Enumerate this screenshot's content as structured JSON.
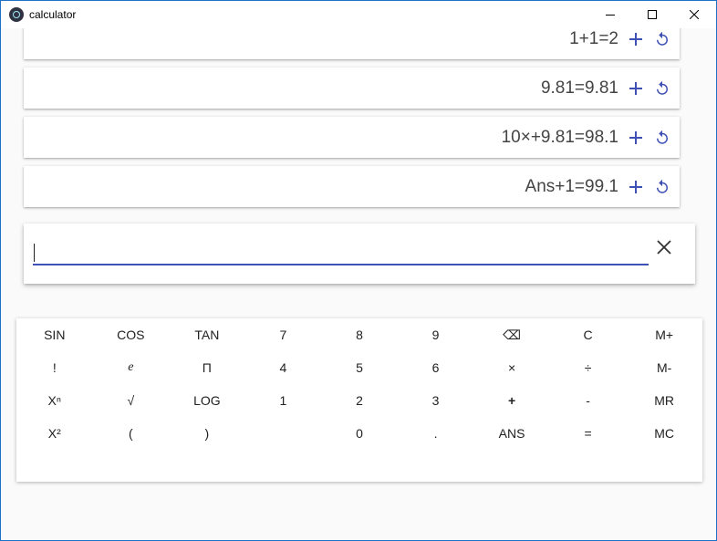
{
  "window": {
    "title": "calculator"
  },
  "history": [
    {
      "expression": "1+1=2"
    },
    {
      "expression": "9.81=9.81"
    },
    {
      "expression": "10×+9.81=98.1"
    },
    {
      "expression": "Ans+1=99.1"
    }
  ],
  "input": {
    "value": "",
    "placeholder": ""
  },
  "keypad": {
    "keys": [
      "SIN",
      "COS",
      "TAN",
      "7",
      "8",
      "9",
      "⌫",
      "C",
      "M+",
      "!",
      "e",
      "Π",
      "4",
      "5",
      "6",
      "×",
      "÷",
      "M-",
      "Xⁿ",
      "√",
      "LOG",
      "1",
      "2",
      "3",
      "+",
      "-",
      "MR",
      "X²",
      "(",
      ")",
      "",
      "0",
      ".",
      "ANS",
      "=",
      "MC"
    ]
  },
  "colors": {
    "accent": "#3f51b5",
    "window_border": "#1a73c9",
    "background": "#fafafa"
  }
}
